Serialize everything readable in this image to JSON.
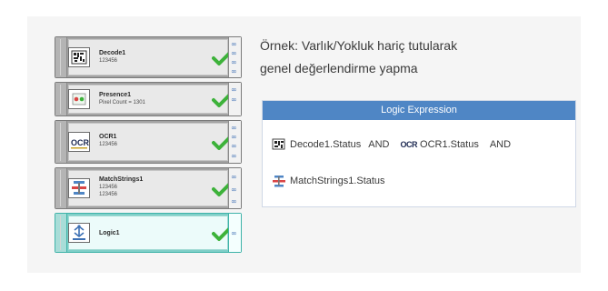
{
  "description": {
    "line1": "Örnek: Varlık/Yokluk hariç tutularak",
    "line2": "genel değerlendirme yapma"
  },
  "tools": [
    {
      "name": "Decode1",
      "sub1": "123456",
      "sub2": "",
      "icon": "barcode-icon"
    },
    {
      "name": "Presence1",
      "sub1": "Pixel Count = 1301",
      "sub2": "",
      "icon": "presence-icon"
    },
    {
      "name": "OCR1",
      "sub1": "123456",
      "sub2": "",
      "icon": "ocr-icon"
    },
    {
      "name": "MatchStrings1",
      "sub1": "123456",
      "sub2": "123456",
      "icon": "match-strings-icon"
    },
    {
      "name": "Logic1",
      "sub1": "",
      "sub2": "",
      "icon": "logic-icon"
    }
  ],
  "logic": {
    "header": "Logic Expression",
    "term1": "Decode1.Status",
    "op1": "AND",
    "ocr_glyph": "OCR",
    "term2": "OCR1.Status",
    "op2": "AND",
    "term3": "MatchStrings1.Status"
  },
  "colors": {
    "header_blue": "#4f86c5",
    "check_green": "#3db23a",
    "active_teal": "#3fb3a9"
  }
}
